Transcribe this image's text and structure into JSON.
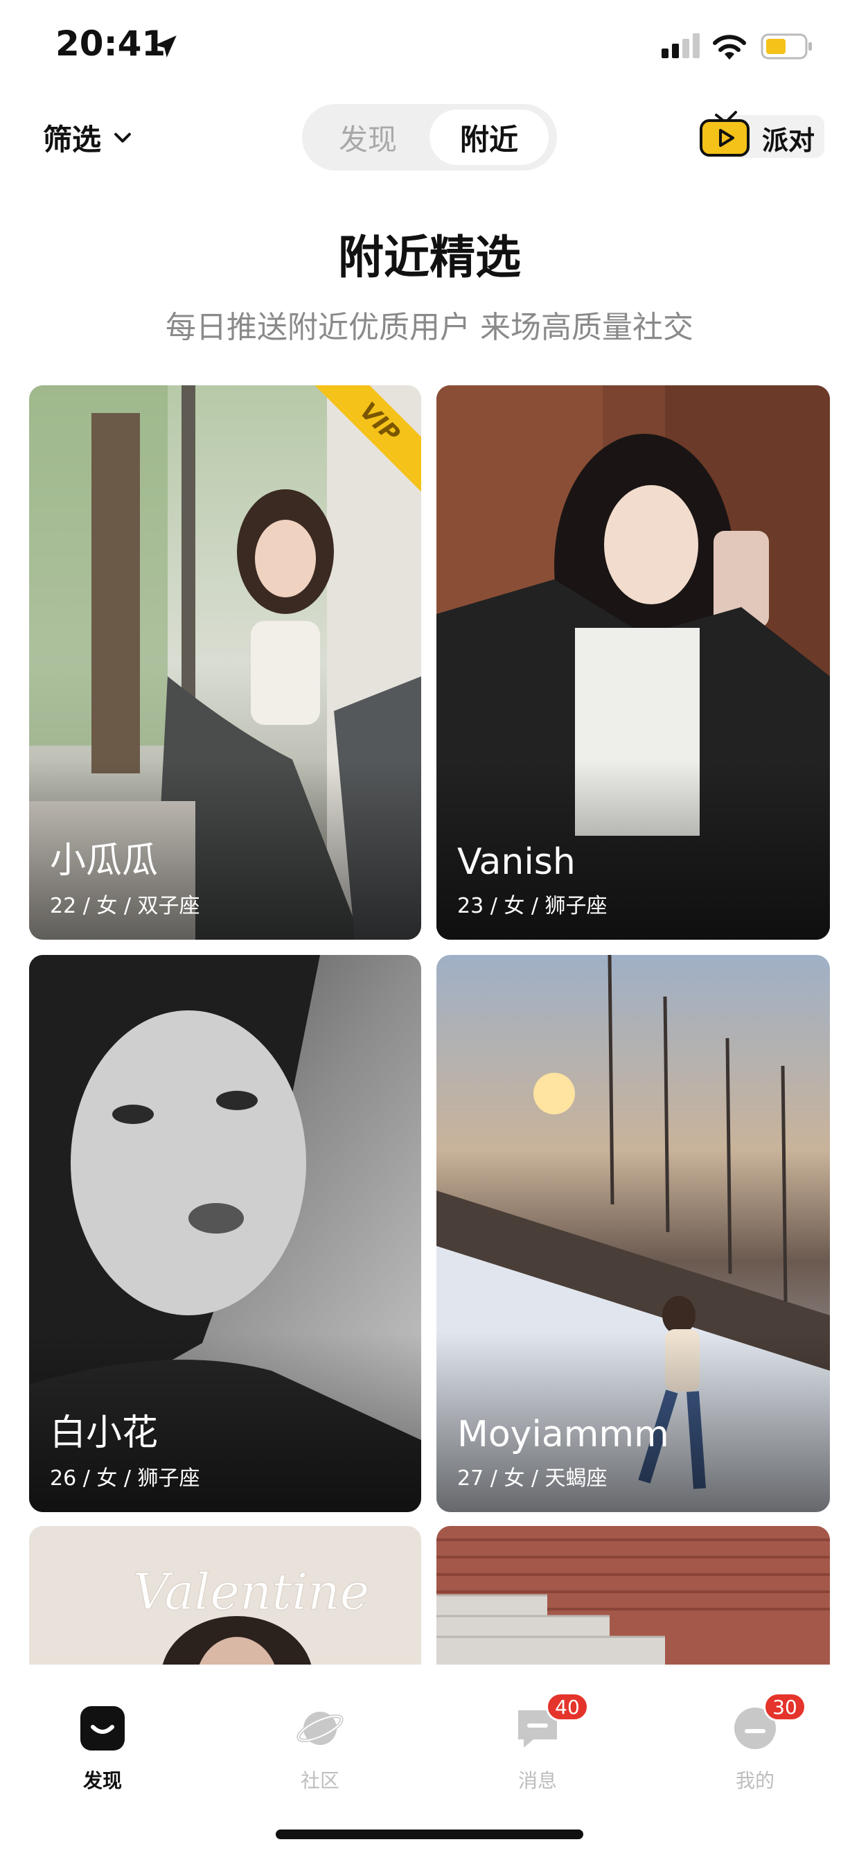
{
  "status_bar": {
    "time": "20:41"
  },
  "nav": {
    "filter_label": "筛选",
    "segment": {
      "tabs": [
        "发现",
        "附近"
      ],
      "active": "附近"
    },
    "party_label": "派对"
  },
  "heading": {
    "title": "附近精选",
    "subtitle": "每日推送附近优质用户 来场高质量社交"
  },
  "cards": [
    {
      "name": "小瓜瓜",
      "meta": "22 / 女 / 双子座",
      "vip": "VIP"
    },
    {
      "name": "Vanish",
      "meta": "23 / 女 / 狮子座"
    },
    {
      "name": "白小花",
      "meta": "26 / 女 / 狮子座"
    },
    {
      "name": "Moyiammm",
      "meta": "27 / 女 / 天蝎座"
    },
    {
      "caption": "Valentine"
    }
  ],
  "tabbar": {
    "items": [
      {
        "label": "发现",
        "icon": "discover-icon",
        "active": true
      },
      {
        "label": "社区",
        "icon": "planet-icon"
      },
      {
        "label": "消息",
        "icon": "message-icon",
        "badge": "40"
      },
      {
        "label": "我的",
        "icon": "profile-icon",
        "badge": "30"
      }
    ]
  },
  "colors": {
    "accent": "#f5c21a",
    "badge": "#e5342b",
    "inactive": "#bdbdbd"
  }
}
